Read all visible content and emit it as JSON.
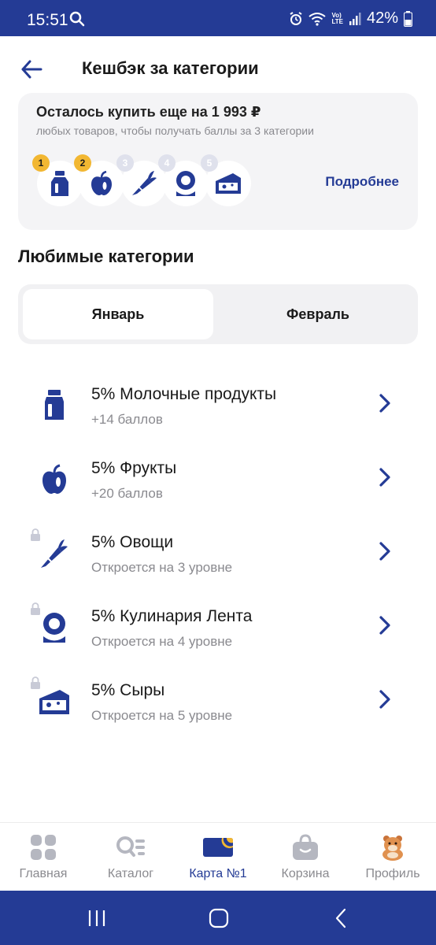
{
  "status_bar": {
    "time": "15:51",
    "battery": "42%",
    "lte_label": "LTE",
    "volte_label": "Vo)"
  },
  "header": {
    "title": "Кешбэк за категории",
    "back_icon": "arrow-left-icon"
  },
  "progress_card": {
    "headline": "Осталось купить еще на 1 993 ₽",
    "subtitle": "любых товаров, чтобы получать баллы за 3 категории",
    "more_link": "Подробнее",
    "levels": [
      {
        "number": "1",
        "icon": "milk-icon",
        "reached": true
      },
      {
        "number": "2",
        "icon": "apple-icon",
        "reached": true
      },
      {
        "number": "3",
        "icon": "carrot-icon",
        "reached": false
      },
      {
        "number": "4",
        "icon": "location-flower-icon",
        "reached": false
      },
      {
        "number": "5",
        "icon": "cheese-icon",
        "reached": false
      }
    ]
  },
  "favorites": {
    "title": "Любимые категории",
    "tabs": [
      {
        "label": "Январь",
        "selected": true
      },
      {
        "label": "Февраль",
        "selected": false
      }
    ],
    "categories": [
      {
        "name": "5% Молочные продукты",
        "desc": "+14 баллов",
        "icon": "milk-icon",
        "locked": false
      },
      {
        "name": "5% Фрукты",
        "desc": "+20 баллов",
        "icon": "apple-icon",
        "locked": false
      },
      {
        "name": "5% Овощи",
        "desc": "Откроется на 3 уровне",
        "icon": "carrot-icon",
        "locked": true
      },
      {
        "name": "5% Кулинария Лента",
        "desc": "Откроется на 4 уровне",
        "icon": "location-flower-icon",
        "locked": true
      },
      {
        "name": "5% Сыры",
        "desc": "Откроется на 5 уровне",
        "icon": "cheese-icon",
        "locked": true
      }
    ]
  },
  "bottom_nav": [
    {
      "label": "Главная",
      "icon": "home-grid-icon",
      "active": false
    },
    {
      "label": "Каталог",
      "icon": "catalog-search-icon",
      "active": false
    },
    {
      "label": "Карта №1",
      "icon": "loyalty-card-icon",
      "active": true
    },
    {
      "label": "Корзина",
      "icon": "basket-icon",
      "active": false
    },
    {
      "label": "Профиль",
      "icon": "hamster-avatar-icon",
      "active": false
    }
  ],
  "colors": {
    "brand_blue": "#243b95",
    "badge_yellow": "#f2b732",
    "muted_text": "#8a8a8f",
    "card_bg": "#f4f4f6"
  }
}
